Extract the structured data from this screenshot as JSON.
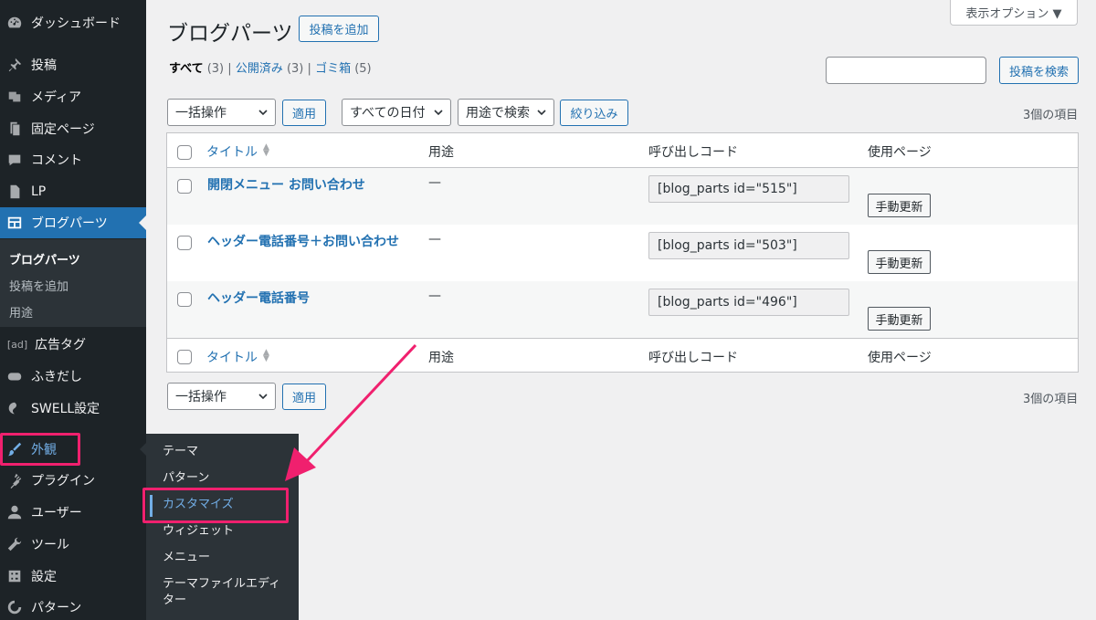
{
  "sidebar": {
    "items": [
      {
        "label": "ダッシュボード",
        "icon": "dashboard-icon"
      },
      {
        "label": "投稿",
        "icon": "pin-icon"
      },
      {
        "label": "メディア",
        "icon": "media-icon"
      },
      {
        "label": "固定ページ",
        "icon": "page-icon"
      },
      {
        "label": "コメント",
        "icon": "comment-icon"
      },
      {
        "label": "LP",
        "icon": "document-icon"
      },
      {
        "label": "ブログパーツ",
        "icon": "blog-parts-icon"
      },
      {
        "label": "広告タグ",
        "icon": "ad-icon"
      },
      {
        "label": "ふきだし",
        "icon": "balloon-icon"
      },
      {
        "label": "SWELL設定",
        "icon": "swell-icon"
      },
      {
        "label": "外観",
        "icon": "brush-icon"
      },
      {
        "label": "プラグイン",
        "icon": "plugin-icon"
      },
      {
        "label": "ユーザー",
        "icon": "user-icon"
      },
      {
        "label": "ツール",
        "icon": "wrench-icon"
      },
      {
        "label": "設定",
        "icon": "settings-icon"
      },
      {
        "label": "パターン",
        "icon": "pattern-icon"
      }
    ],
    "ad_icon_text": "[ad]",
    "submenu": [
      "ブログパーツ",
      "投稿を追加",
      "用途"
    ]
  },
  "flyout": {
    "items": [
      "テーマ",
      "パターン",
      "カスタマイズ",
      "ウィジェット",
      "メニュー",
      "テーマファイルエディ",
      "ター"
    ]
  },
  "header": {
    "title": "ブログパーツ",
    "add_new": "投稿を追加",
    "screen_options": "表示オプション ▼"
  },
  "views": {
    "all": "すべて",
    "all_count": "(3)",
    "published": "公開済み",
    "published_count": "(3)",
    "trash": "ゴミ箱",
    "trash_count": "(5)",
    "sep": "|"
  },
  "search": {
    "button": "投稿を検索",
    "value": ""
  },
  "filters": {
    "bulk_action": "一括操作",
    "apply": "適用",
    "dates": "すべての日付",
    "usage": "用途で検索",
    "filter": "絞り込み"
  },
  "item_count": "3個の項目",
  "table": {
    "columns": [
      "タイトル",
      "用途",
      "呼び出しコード",
      "使用ページ"
    ],
    "rows": [
      {
        "title": "開閉メニュー お問い合わせ",
        "usage": "—",
        "code": "[blog_parts id=\"515\"]",
        "action": "手動更新"
      },
      {
        "title": "ヘッダー電話番号＋お問い合わせ",
        "usage": "—",
        "code": "[blog_parts id=\"503\"]",
        "action": "手動更新"
      },
      {
        "title": "ヘッダー電話番号",
        "usage": "—",
        "code": "[blog_parts id=\"496\"]",
        "action": "手動更新"
      }
    ]
  },
  "colors": {
    "accent": "#2271b1",
    "highlight": "#f0206e",
    "sidebar": "#1d2327"
  }
}
